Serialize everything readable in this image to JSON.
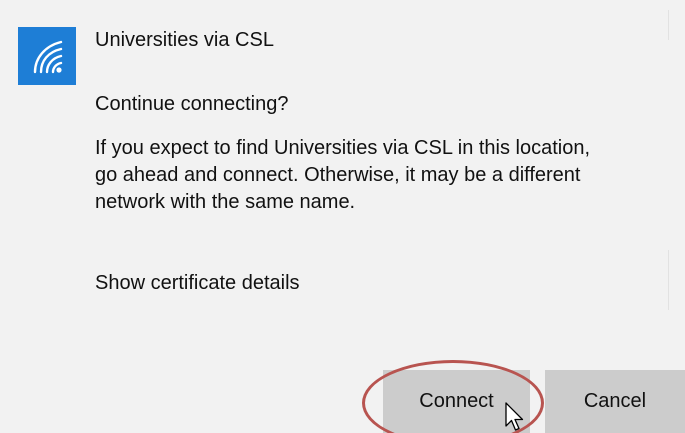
{
  "network": {
    "name": "Universities via CSL",
    "icon": "wifi-secured-icon"
  },
  "prompt": {
    "question": "Continue connecting?",
    "message_lines": [
      "If you expect to find Universities via CSL in this location,",
      "go ahead and connect. Otherwise, it may be a different",
      "network with the same name."
    ],
    "certificate_link": "Show certificate details"
  },
  "buttons": {
    "connect_label": "Connect",
    "cancel_label": "Cancel"
  },
  "colors": {
    "accent": "#1e7ed6",
    "panel_background": "#f2f2f2",
    "button_background": "#cccccc",
    "highlight_ring": "#b85450"
  }
}
